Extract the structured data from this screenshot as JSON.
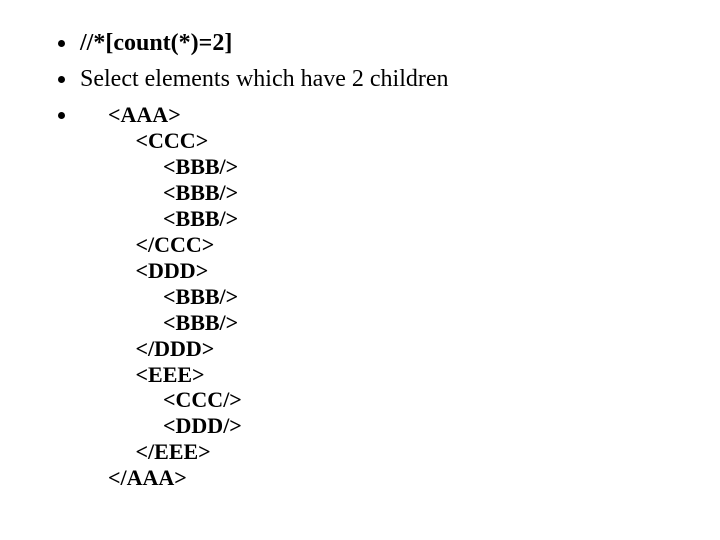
{
  "bullets": {
    "b1": "//*[count(*)=2]",
    "b2": "Select elements which have 2 children"
  },
  "code": "<AAA>\n     <CCC>\n          <BBB/>\n          <BBB/>\n          <BBB/>\n     </CCC>\n     <DDD>\n          <BBB/>\n          <BBB/>\n     </DDD>\n     <EEE>\n          <CCC/>\n          <DDD/>\n     </EEE>\n</AAA>"
}
